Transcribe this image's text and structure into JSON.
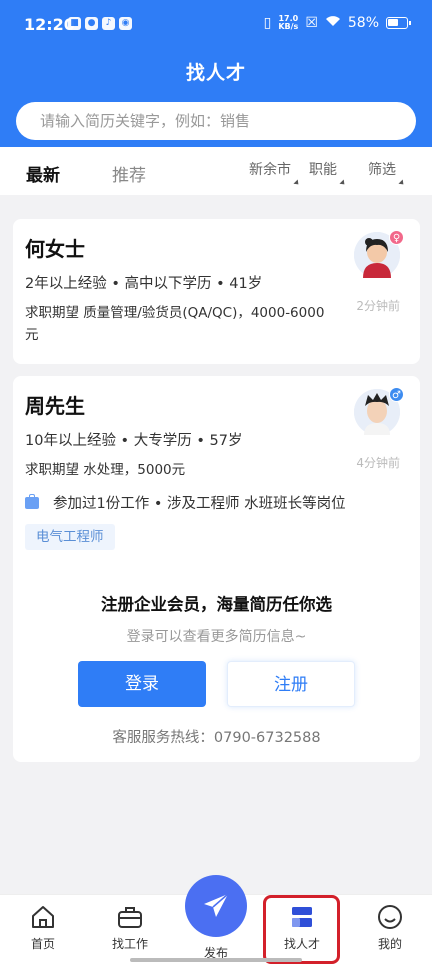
{
  "status_bar": {
    "time": "12:20",
    "net_speed": "17.0",
    "net_unit": "KB/s",
    "battery": "58%"
  },
  "header": {
    "title": "找人才",
    "search_placeholder": "请输入简历关键字，例如：销售"
  },
  "filters": {
    "tabs": [
      "最新",
      "推荐"
    ],
    "city": "新余市",
    "function": "职能",
    "sort": "筛选"
  },
  "candidates": [
    {
      "name": "何女士",
      "meta": "2年以上经验 • 高中以下学历 • 41岁",
      "expect": "求职期望 质量管理/验货员(QA/QC)，4000-6000元",
      "gender_symbol": "♀",
      "posted": "2分钟前"
    },
    {
      "name": "周先生",
      "meta": "10年以上经验 • 大专学历 • 57岁",
      "expect": "求职期望 水处理，5000元",
      "gender_symbol": "♂",
      "posted": "4分钟前",
      "work_summary": "参加过1份工作 • 涉及工程师 水班班长等岗位",
      "tag": "电气工程师"
    }
  ],
  "membership": {
    "title": "注册企业会员，海量简历任你选",
    "subtitle": "登录可以查看更多简历信息~",
    "login_label": "登录",
    "register_label": "注册",
    "hotline": "客服服务热线：0790-6732588"
  },
  "bottom_nav": {
    "home": "首页",
    "jobs": "找工作",
    "publish": "发布",
    "talent": "找人才",
    "mine": "我的"
  },
  "colors": {
    "primary": "#2f7df6",
    "publish_button": "#4b6ff2",
    "highlight": "#d3202a"
  }
}
